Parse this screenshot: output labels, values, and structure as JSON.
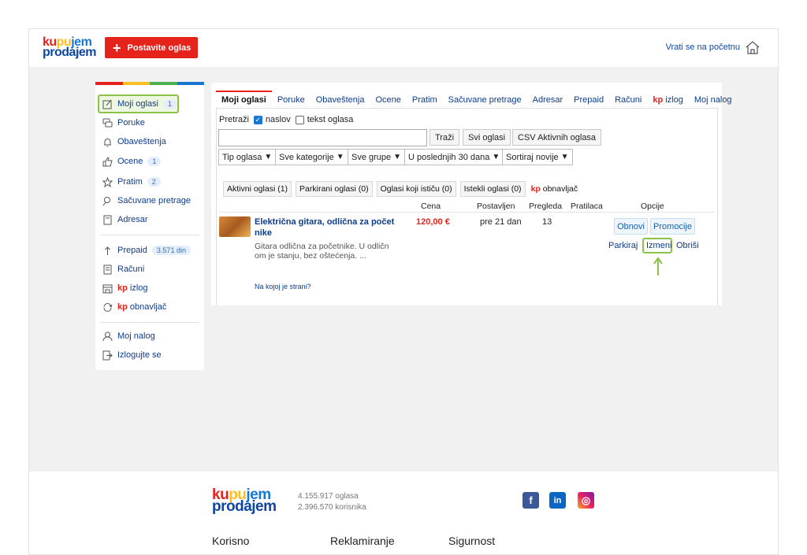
{
  "header": {
    "logo_line1": [
      "ku",
      "pu",
      "jem"
    ],
    "logo_line2": "prodajem",
    "post_ad_label": "Postavite oglas",
    "back_home_label": "Vrati se na početnu"
  },
  "colors": {
    "brand_red": "#e5231b",
    "brand_blue": "#0d47a1",
    "highlight_green": "#8bc34a",
    "rainbow": [
      "#e5231b",
      "#fbbf24",
      "#4caf50",
      "#1976d2"
    ]
  },
  "sidebar": {
    "items": [
      {
        "label": "Moji oglasi",
        "badge": "1",
        "icon": "edit-icon"
      },
      {
        "label": "Poruke",
        "badge": "",
        "icon": "chat-icon"
      },
      {
        "label": "Obaveštenja",
        "badge": "",
        "icon": "bell-icon"
      },
      {
        "label": "Ocene",
        "badge": "1",
        "icon": "thumbs-up-icon"
      },
      {
        "label": "Pratim",
        "badge": "2",
        "icon": "star-icon"
      },
      {
        "label": "Sačuvane pretrage",
        "badge": "",
        "icon": "saved-search-icon"
      },
      {
        "label": "Adresar",
        "badge": "",
        "icon": "address-book-icon"
      },
      {
        "label": "Prepaid",
        "badge": "3.571 din",
        "icon": "prepaid-icon"
      },
      {
        "label": "Računi",
        "badge": "",
        "icon": "receipt-icon"
      },
      {
        "label_kp": "kp",
        "label": "izlog",
        "badge": "",
        "icon": "storefront-icon"
      },
      {
        "label_kp": "kp",
        "label": "obnavljač",
        "badge": "",
        "icon": "refresh-icon"
      },
      {
        "label": "Moj nalog",
        "badge": "",
        "icon": "user-icon"
      },
      {
        "label": "Izlogujte se",
        "badge": "",
        "icon": "logout-icon"
      }
    ]
  },
  "tabs": [
    {
      "label": "Moji oglasi",
      "active": true
    },
    {
      "label": "Poruke"
    },
    {
      "label": "Obaveštenja"
    },
    {
      "label": "Ocene"
    },
    {
      "label": "Pratim"
    },
    {
      "label": "Sačuvane pretrage"
    },
    {
      "label": "Adresar"
    },
    {
      "label": "Prepaid"
    },
    {
      "label": "Računi"
    },
    {
      "label_kp": "kp",
      "label": "izlog"
    },
    {
      "label": "Moj nalog"
    }
  ],
  "search": {
    "label": "Pretraži",
    "opt_title": "naslov",
    "opt_text": "tekst oglasa",
    "opt_title_checked": true,
    "opt_text_checked": false,
    "input_value": "",
    "search_btn": "Traži",
    "all_ads_btn": "Svi oglasi",
    "csv_btn": "CSV Aktivnih oglasa"
  },
  "filters": [
    "Tip oglasa",
    "Sve kategorije",
    "Sve grupe",
    "U poslednjih 30 dana",
    "Sortiraj novije"
  ],
  "subtabs": [
    {
      "label": "Aktivni oglasi (1)"
    },
    {
      "label": "Parkirani oglasi (0)"
    },
    {
      "label": "Oglasi koji ističu (0)"
    },
    {
      "label": "Istekli oglasi (0)"
    },
    {
      "label_kp": "kp",
      "label": "obnavljač"
    }
  ],
  "columns": [
    "Cena",
    "Postavljen",
    "Pregleda",
    "Pratilaca",
    "Opcije"
  ],
  "ad": {
    "title_line1": "Električna gitara, odlična za počet",
    "title_line2": "nike",
    "desc_line1": "Gitara odlična za početnike. U odličn",
    "desc_line2": "om je stanju, bez oštećenja. ...",
    "price": "120,00 €",
    "posted": "pre 21 dan",
    "views": "13",
    "followers": "",
    "renew_btn": "Obnovi",
    "promo_btn": "Promocije",
    "park_link": "Parkiraj",
    "edit_link": "Izmeni",
    "delete_link": "Obriši",
    "which_page": "Na kojoj je strani?"
  },
  "footer": {
    "logo_line1": [
      "ku",
      "pu",
      "jem"
    ],
    "logo_line2": "prodajem",
    "ads_count": "4.155.917 oglasa",
    "users_count": "2.396.570 korisnika",
    "social": [
      "f",
      "in",
      "◎"
    ],
    "columns": [
      "Korisno",
      "Reklamiranje",
      "Sigurnost"
    ]
  }
}
